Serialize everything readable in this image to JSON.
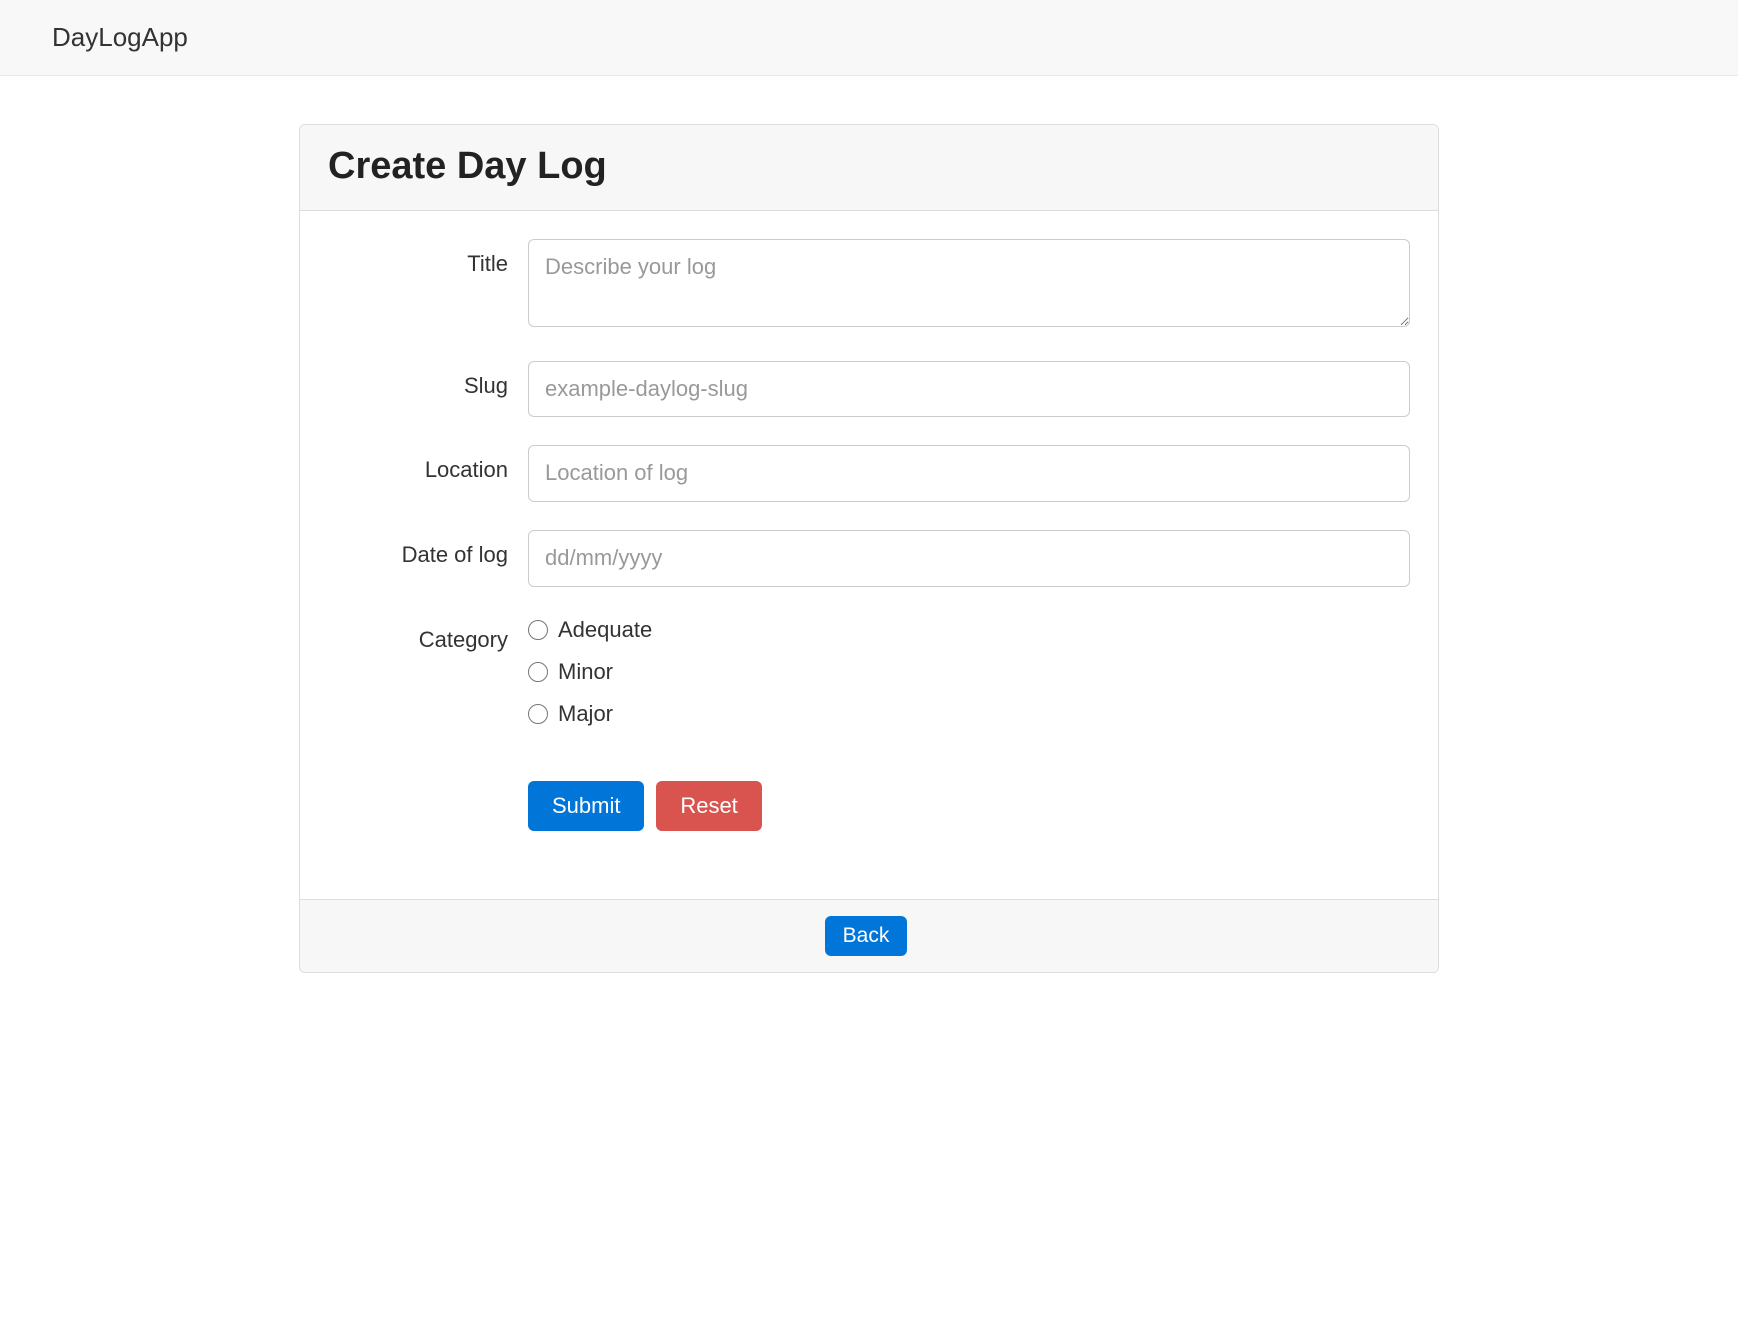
{
  "navbar": {
    "brand": "DayLogApp"
  },
  "panel": {
    "title": "Create Day Log"
  },
  "form": {
    "title": {
      "label": "Title",
      "placeholder": "Describe your log",
      "value": ""
    },
    "slug": {
      "label": "Slug",
      "placeholder": "example-daylog-slug",
      "value": ""
    },
    "location": {
      "label": "Location",
      "placeholder": "Location of log",
      "value": ""
    },
    "date": {
      "label": "Date of log",
      "placeholder": "dd/mm/yyyy",
      "value": ""
    },
    "category": {
      "label": "Category",
      "options": [
        "Adequate",
        "Minor",
        "Major"
      ]
    },
    "submit_label": "Submit",
    "reset_label": "Reset"
  },
  "footer": {
    "back_label": "Back"
  }
}
